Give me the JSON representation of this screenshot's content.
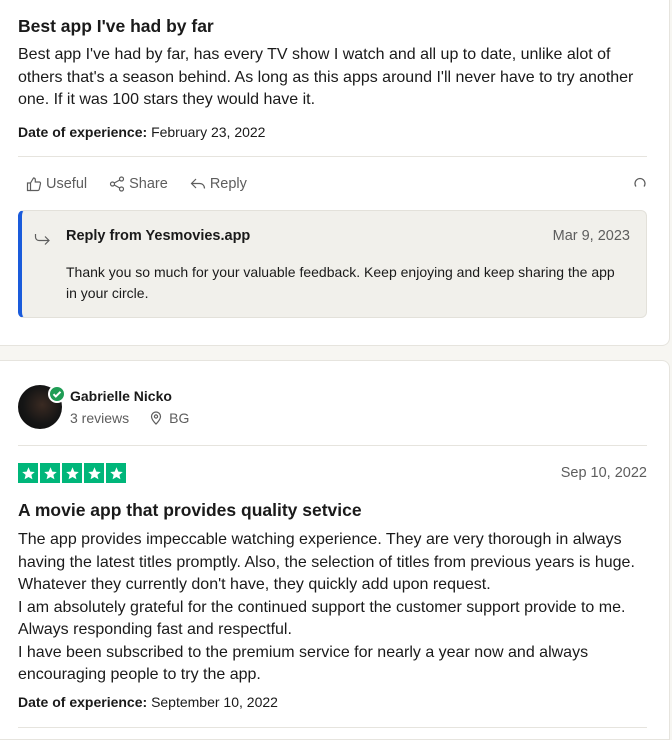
{
  "review1": {
    "title": "Best app I've had by far",
    "body": "Best app I've had by far, has every TV show I watch and all up to date, unlike alot of others that's a season behind. As long as this apps around I'll never have to try another one. If it was 100 stars they would have it.",
    "doe_label": "Date of experience:",
    "doe_value": "February 23, 2022",
    "actions": {
      "useful": "Useful",
      "share": "Share",
      "reply": "Reply"
    },
    "reply": {
      "from": "Reply from Yesmovies.app",
      "date": "Mar 9, 2023",
      "text": "Thank you so much for your valuable feedback. Keep enjoying and keep sharing the app in your circle."
    }
  },
  "review2": {
    "reviewer_name": "Gabrielle Nicko",
    "review_count": "3 reviews",
    "country": "BG",
    "rating": 5,
    "date": "Sep 10, 2022",
    "title": "A movie app that provides quality setvice",
    "body_lines": [
      "The app provides impeccable watching experience. They are very thorough in always having the latest titles promptly. Also, the selection of titles from previous years is huge. Whatever they currently don't have, they quickly add upon request.",
      "I am absolutely grateful for the continued support the customer support provide to me. Always responding fast and respectful.",
      "I have been subscribed to the premium service for nearly a year now and always encouraging people to try the app."
    ],
    "doe_label": "Date of experience:",
    "doe_value": "September 10, 2022"
  },
  "colors": {
    "star_green": "#00b67a",
    "reply_accent": "#1a5bdb",
    "verified_green": "#1f9d55"
  }
}
